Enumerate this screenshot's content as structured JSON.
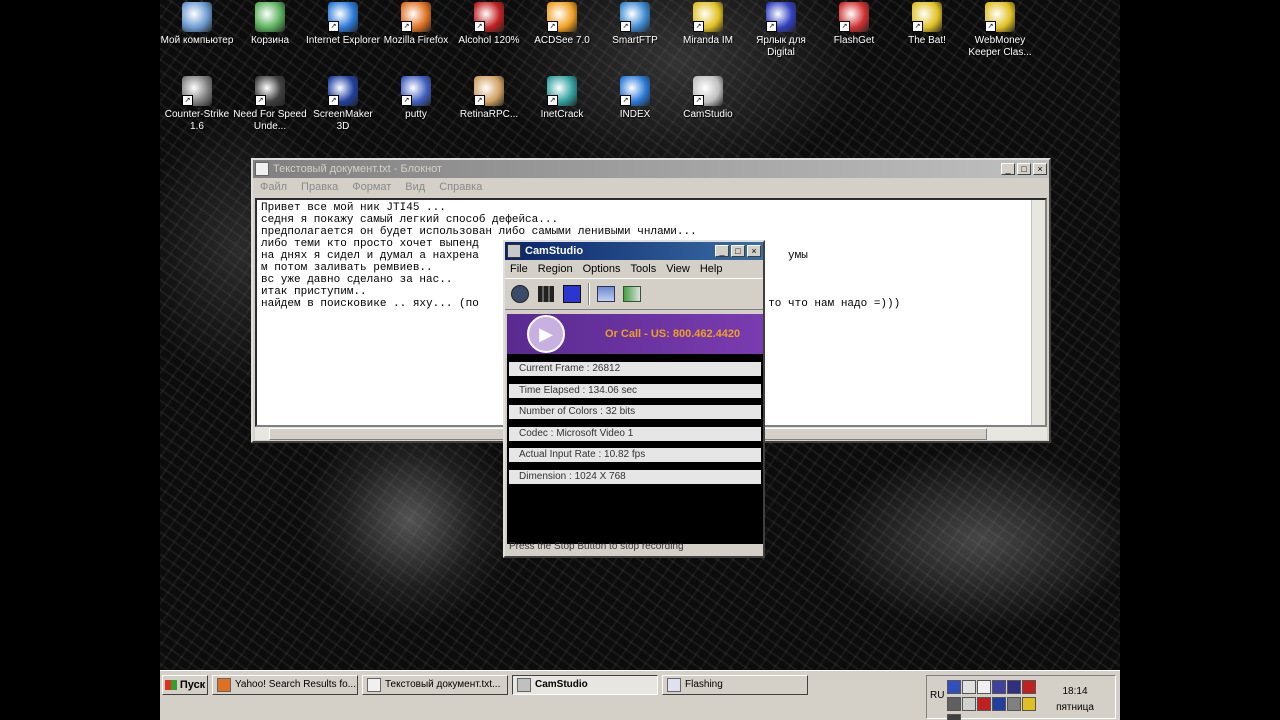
{
  "desktop": {
    "icons": [
      {
        "label": "Мой компьютер",
        "icon": "my-computer-icon",
        "color": "#6a9ad0"
      },
      {
        "label": "Корзина",
        "icon": "recycle-bin-icon",
        "color": "#5ab05a"
      },
      {
        "label": "Internet Explorer",
        "icon": "ie-icon",
        "color": "#2a7ad8"
      },
      {
        "label": "Mozilla Firefox",
        "icon": "firefox-icon",
        "color": "#e07020"
      },
      {
        "label": "Alcohol 120%",
        "icon": "alcohol-icon",
        "color": "#c02020"
      },
      {
        "label": "ACDSee 7.0",
        "icon": "acdsee-icon",
        "color": "#f0a020"
      },
      {
        "label": "SmartFTP",
        "icon": "smartftp-icon",
        "color": "#3a8ad0"
      },
      {
        "label": "Miranda IM",
        "icon": "miranda-icon",
        "color": "#e0c020"
      },
      {
        "label": "Ярлык для Digital",
        "icon": "digital-icon",
        "color": "#3040c0"
      },
      {
        "label": "FlashGet",
        "icon": "flashget-icon",
        "color": "#d03030"
      },
      {
        "label": "The Bat!",
        "icon": "the-bat-icon",
        "color": "#e0c020"
      },
      {
        "label": "WebMoney Keeper Clas...",
        "icon": "webmoney-icon",
        "color": "#e0c020"
      },
      {
        "label": "Counter-Strike 1.6",
        "icon": "counter-strike-icon",
        "color": "#808080"
      },
      {
        "label": "Need For Speed Unde...",
        "icon": "nfs-icon",
        "color": "#404040"
      },
      {
        "label": "ScreenMaker 3D",
        "icon": "screenmaker-icon",
        "color": "#2040a0"
      },
      {
        "label": "putty",
        "icon": "putty-icon",
        "color": "#4060c0"
      },
      {
        "label": "RetinaRPC...",
        "icon": "retinarpc-icon",
        "color": "#d0a060"
      },
      {
        "label": "InetCrack",
        "icon": "inetcrack-icon",
        "color": "#30a0a0"
      },
      {
        "label": "INDEX",
        "icon": "index-ie-icon",
        "color": "#2a7ad8"
      },
      {
        "label": "CamStudio",
        "icon": "camstudio-icon",
        "color": "#c0c0c0"
      }
    ]
  },
  "notepad": {
    "title": "Текстовый документ.txt - Блокнот",
    "menu": [
      "Файл",
      "Правка",
      "Формат",
      "Вид",
      "Справка"
    ],
    "lines": [
      "Привет все мой ник JTI45 ...",
      "седня я покажу самый легкий способ дефейса...",
      "предполагается он будет использован либо самыми ленивыми чнлами...",
      "либо теми кто просто хочет выпенд",
      "на днях я сидел и думал а нахрена",
      "м потом заливать ремвиев..",
      "вс уже давно сделано за нас..",
      "итак приступим..",
      "найдем в поисковике .. яху... (по"
    ],
    "right_fragments": [
      "умы",
      "е ищет то что нам надо =)))"
    ]
  },
  "camstudio": {
    "title": "CamStudio",
    "menu": [
      "File",
      "Region",
      "Options",
      "Tools",
      "View",
      "Help"
    ],
    "banner_text": "Or Call -  US: 800.462.4420",
    "stats": [
      "Current Frame : 26812",
      "Time Elapsed  : 134.06 sec",
      "Number of Colors  : 32 bits",
      "Codec  : Microsoft Video 1",
      "Actual Input Rate  : 10.82 fps",
      "Dimension  : 1024 X 768"
    ],
    "status": "Press the Stop Button to stop recording"
  },
  "taskbar": {
    "start_label": "Пуск",
    "tasks": [
      {
        "label": "Yahoo! Search Results fo...",
        "active": false
      },
      {
        "label": "Текстовый документ.txt...",
        "active": false
      },
      {
        "label": "CamStudio",
        "active": true
      },
      {
        "label": "Flashing",
        "active": false
      }
    ],
    "lang": "RU",
    "time": "18:14",
    "day": "пятница"
  }
}
